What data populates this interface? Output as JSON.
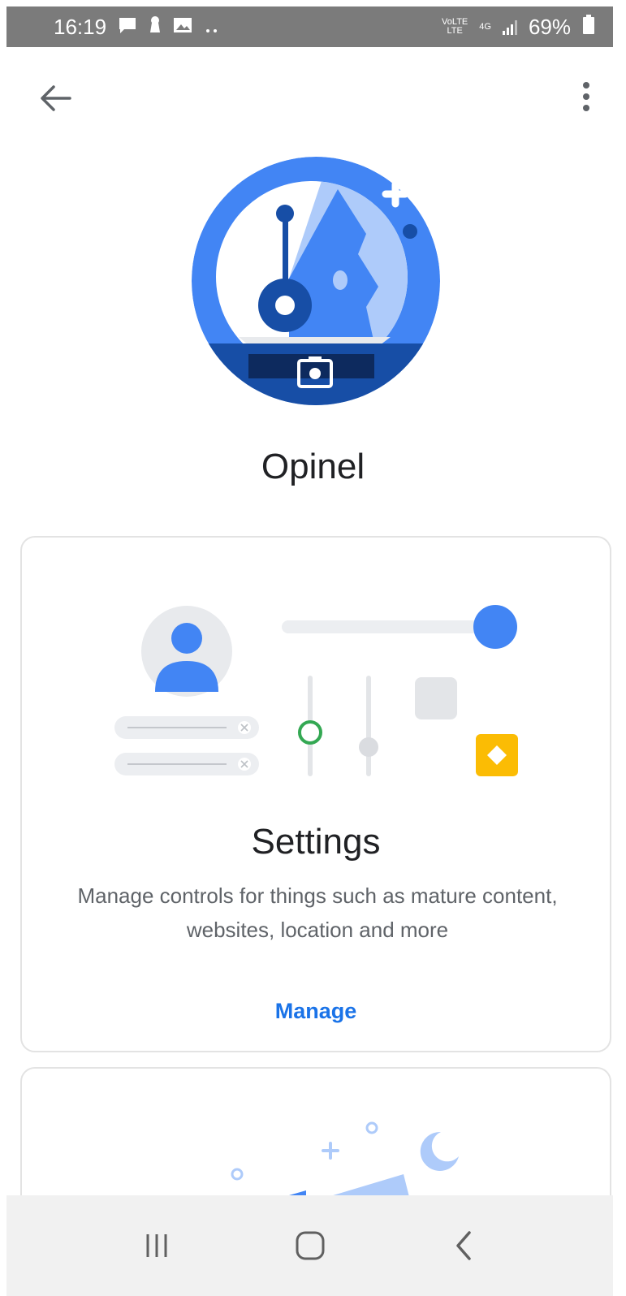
{
  "status_bar": {
    "time": "16:19",
    "network_top": "VoLTE",
    "network_bottom": "LTE",
    "network_type": "4G",
    "battery": "69%",
    "icons": [
      "message-icon",
      "keyhole-icon",
      "image-icon",
      "more-dots-icon",
      "signal-icon",
      "battery-icon"
    ]
  },
  "app_bar": {
    "back_icon": "arrow-back-icon",
    "more_icon": "more-vert-icon"
  },
  "profile": {
    "name": "Opinel"
  },
  "settings_card": {
    "title": "Settings",
    "description": "Manage controls for things such as mature content, websites, location and more",
    "action_label": "Manage"
  },
  "nav_bar": {
    "icons": [
      "recent-apps-icon",
      "home-icon",
      "back-nav-icon"
    ]
  },
  "colors": {
    "primary_blue": "#4285f4",
    "dark_blue": "#174ea6",
    "link_blue": "#1a73e8",
    "yellow": "#fbbc04",
    "green": "#34a853",
    "status_bar_gray": "#7b7b7b",
    "nav_bar_gray": "#f1f1f1"
  }
}
